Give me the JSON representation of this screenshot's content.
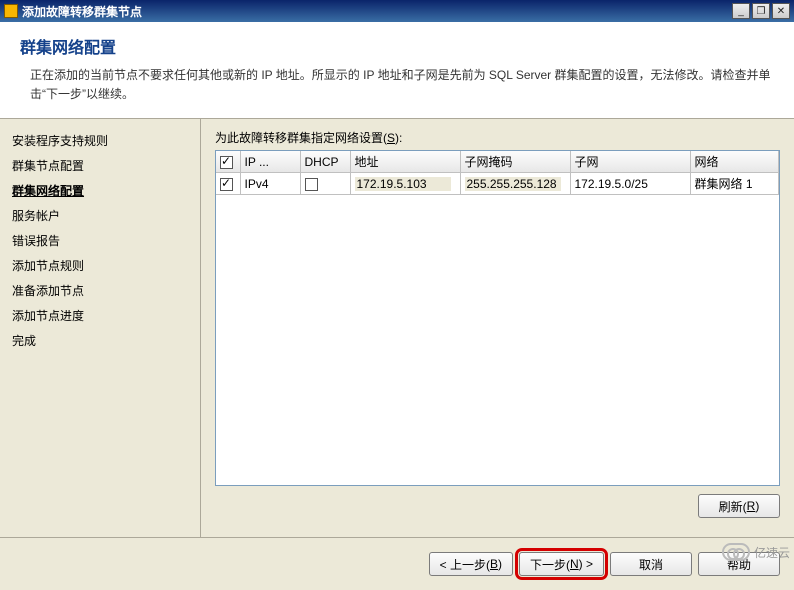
{
  "titlebar": {
    "title": "添加故障转移群集节点"
  },
  "header": {
    "title": "群集网络配置",
    "description": "正在添加的当前节点不要求任何其他或新的 IP 地址。所显示的 IP 地址和子网是先前为 SQL Server 群集配置的设置，无法修改。请检查并单击“下一步”以继续。"
  },
  "sidebar": {
    "items": [
      {
        "label": "安装程序支持规则",
        "active": false
      },
      {
        "label": "群集节点配置",
        "active": false
      },
      {
        "label": "群集网络配置",
        "active": true
      },
      {
        "label": "服务帐户",
        "active": false
      },
      {
        "label": "错误报告",
        "active": false
      },
      {
        "label": "添加节点规则",
        "active": false
      },
      {
        "label": "准备添加节点",
        "active": false
      },
      {
        "label": "添加节点进度",
        "active": false
      },
      {
        "label": "完成",
        "active": false
      }
    ]
  },
  "main": {
    "label_prefix": "为此故障转移群集指定网络设置(",
    "label_hotkey": "S",
    "label_suffix": "):",
    "columns": {
      "ip": "IP ...",
      "dhcp": "DHCP",
      "address": "地址",
      "mask": "子网掩码",
      "subnet": "子网",
      "network": "网络"
    },
    "rows": [
      {
        "checked": true,
        "ip_type": "IPv4",
        "dhcp": false,
        "address": "172.19.5.103",
        "mask": "255.255.255.128",
        "subnet": "172.19.5.0/25",
        "network": "群集网络 1"
      }
    ],
    "refresh_label_prefix": "刷新(",
    "refresh_hotkey": "R",
    "refresh_suffix": ")"
  },
  "footer": {
    "back_prefix": "< 上一步(",
    "back_hotkey": "B",
    "back_suffix": ")",
    "next_prefix": "下一步(",
    "next_hotkey": "N",
    "next_suffix": ") >",
    "cancel": "取消",
    "help": "帮助"
  },
  "watermark": "亿速云"
}
